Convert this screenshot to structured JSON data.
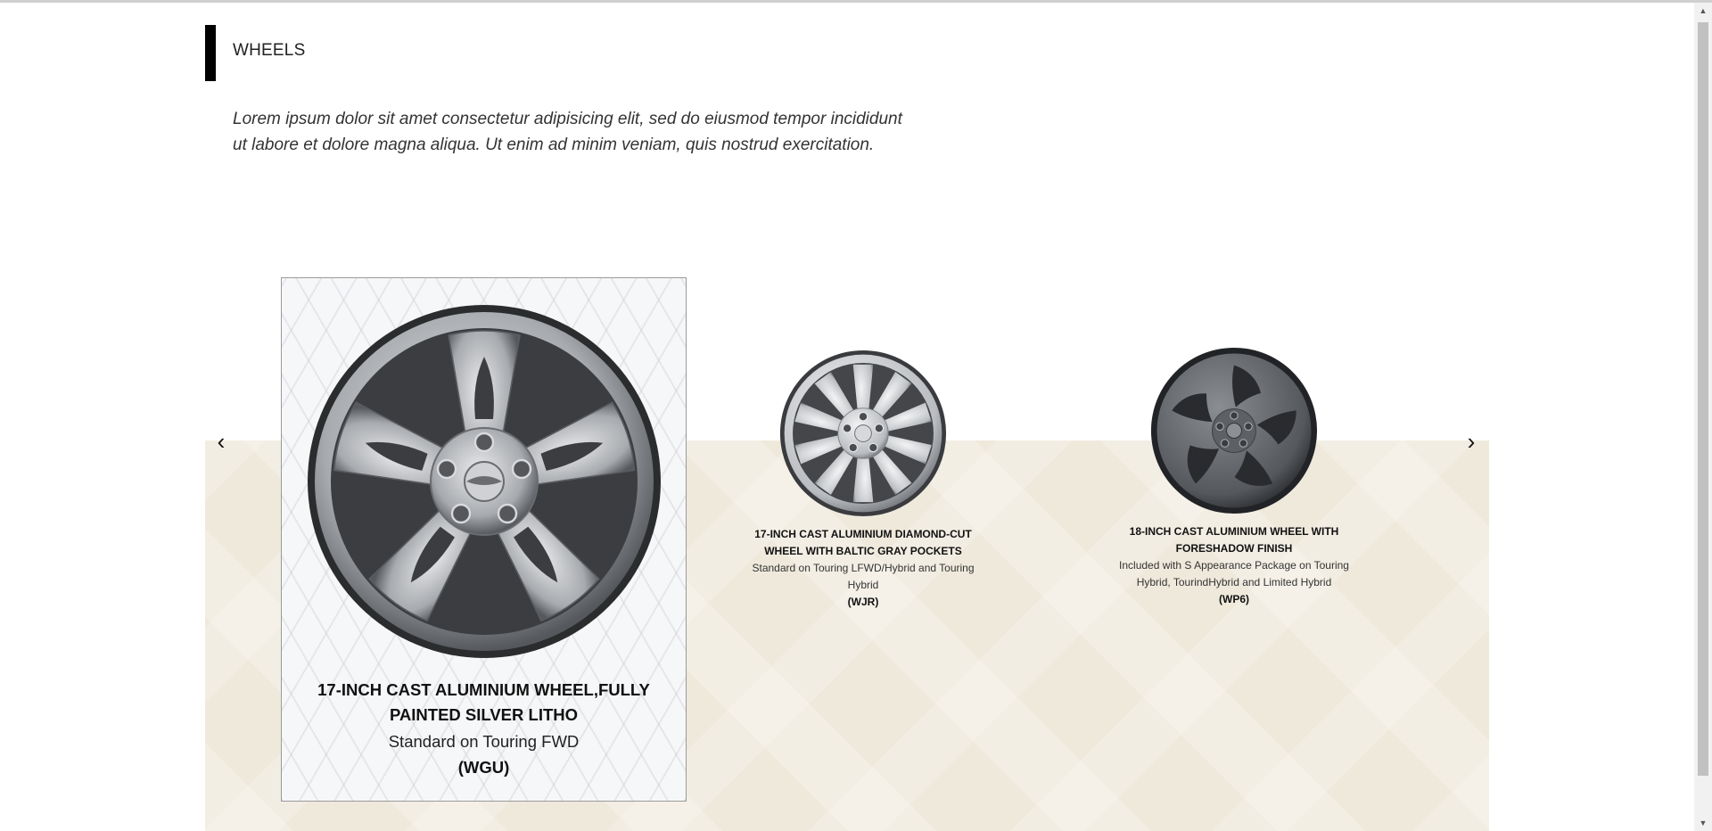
{
  "section": {
    "heading": "WHEELS",
    "intro": "Lorem ipsum dolor sit amet consectetur adipisicing elit, sed do eiusmod tempor incididunt ut labore et dolore magna aliqua. Ut enim ad minim veniam, quis nostrud exercitation."
  },
  "carousel": {
    "prev_icon": "‹",
    "next_icon": "›",
    "items": [
      {
        "title": "17-INCH CAST ALUMINIUM WHEEL,FULLY PAINTED SILVER LITHO",
        "description": "Standard on Touring FWD",
        "code": "(WGU)",
        "active": true
      },
      {
        "title": "17-INCH CAST ALUMINIUM DIAMOND-CUT WHEEL WITH BALTIC GRAY POCKETS",
        "description": "Standard on Touring LFWD/Hybrid and Touring Hybrid",
        "code": "(WJR)",
        "active": false
      },
      {
        "title": "18-INCH CAST ALUMINIUM WHEEL WITH FORESHADOW FINISH",
        "description": "Included with S Appearance Package on Touring Hybrid, TourindHybrid and Limited Hybrid",
        "code": "(WP6)",
        "active": false
      }
    ]
  },
  "colors": {
    "band": "#efe9dc",
    "accent_bar": "#000000",
    "card_border": "#9a9a9a"
  }
}
